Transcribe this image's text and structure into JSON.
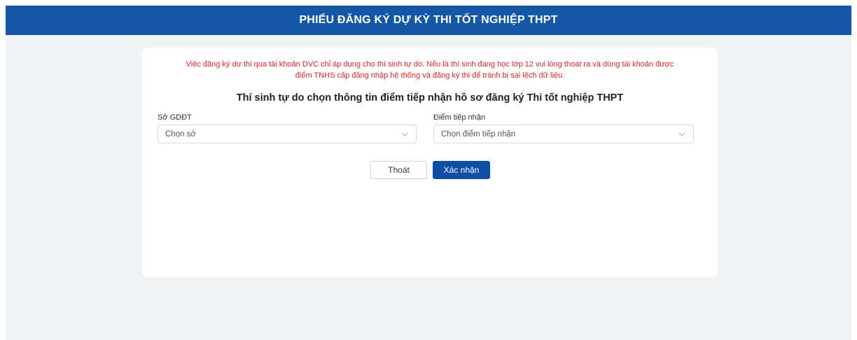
{
  "header": {
    "title": "PHIẾU ĐĂNG KÝ DỰ KỲ THI TỐT NGHIỆP THPT"
  },
  "notice": {
    "line1": "Việc đăng ký dự thi qua tài khoản DVC chỉ áp dụng cho thí sinh tự do. Nếu là thí sinh đang học lớp 12 vui lòng thoát ra và dùng tài khoản được",
    "line2": "điểm TNHS cấp đăng nhập hệ thống và đăng ký thi để tránh bị sai lệch dữ liệu."
  },
  "form": {
    "title": "Thí sinh tự do chọn thông tin điểm tiếp nhận hồ sơ đăng ký Thi tốt nghiệp THPT",
    "department": {
      "label": "Sở GDĐT",
      "placeholder": "Chọn sở",
      "icon": "chevron-down-icon"
    },
    "reception_point": {
      "label": "Điểm tiếp nhận",
      "placeholder": "Chọn điểm tiếp nhận",
      "icon": "chevron-down-icon"
    }
  },
  "actions": {
    "cancel_label": "Thoát",
    "confirm_label": "Xác nhận"
  },
  "colors": {
    "header_bg": "#1457a6",
    "notice_text": "#d42525",
    "primary_button": "#0d4ea6",
    "page_bg": "#f1f2f4"
  }
}
